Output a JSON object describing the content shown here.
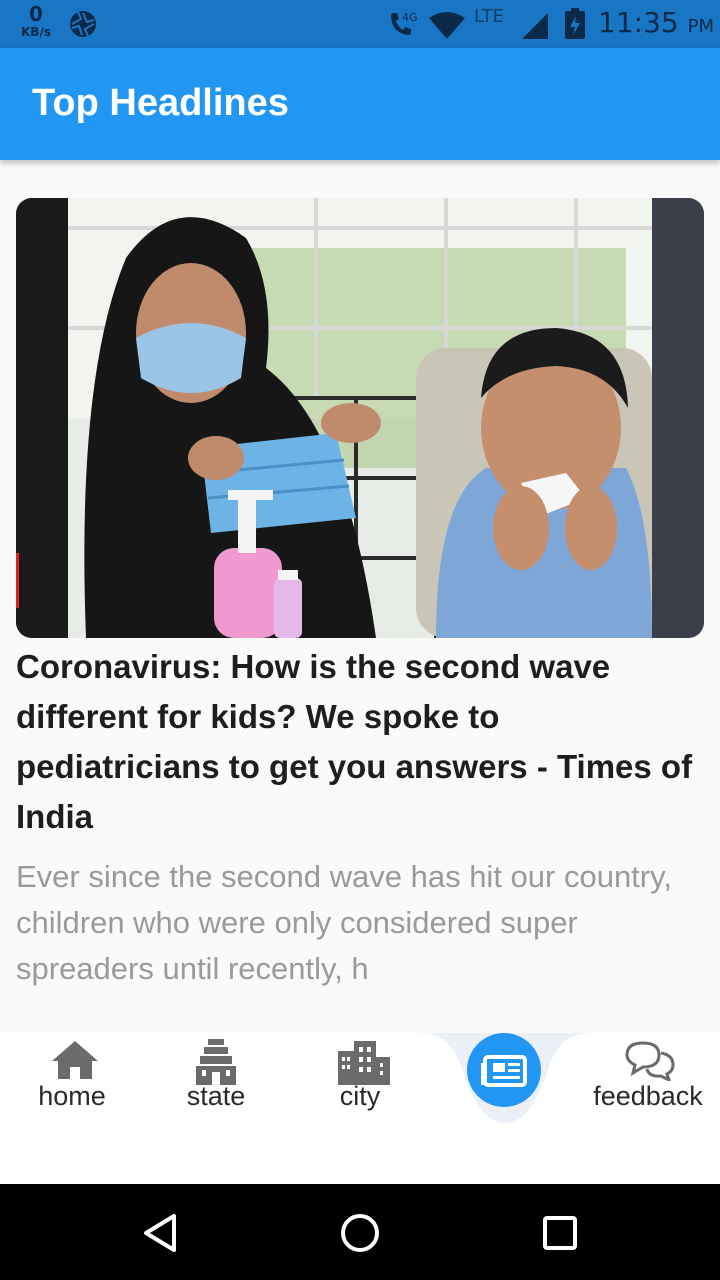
{
  "status_bar": {
    "speed_value": "0",
    "speed_unit": "KB/s",
    "network_label": "4G",
    "lte_label": "LTE",
    "time": "11:35",
    "ampm": "PM"
  },
  "app_bar": {
    "title": "Top Headlines"
  },
  "article": {
    "image_icon": "news-photo-woman-mask-boy-sneezing",
    "headline": "Coronavirus: How is the second wave different for kids? We spoke to pediatricians to get you answers - Times of India",
    "description": "Ever since the second wave has hit our country, children who were only considered super spreaders until recently, h"
  },
  "bottom_nav": {
    "items": [
      {
        "label": "home",
        "icon": "home-icon"
      },
      {
        "label": "state",
        "icon": "temple-icon"
      },
      {
        "label": "city",
        "icon": "city-icon"
      },
      {
        "label": "",
        "icon": "newspaper-icon",
        "selected": true
      },
      {
        "label": "feedback",
        "icon": "chat-bubbles-icon"
      }
    ]
  },
  "colors": {
    "primary": "#2196f3",
    "status_bar": "#1976c4",
    "headline_text": "#1e1e1e",
    "description_text": "#9a9a9a"
  }
}
